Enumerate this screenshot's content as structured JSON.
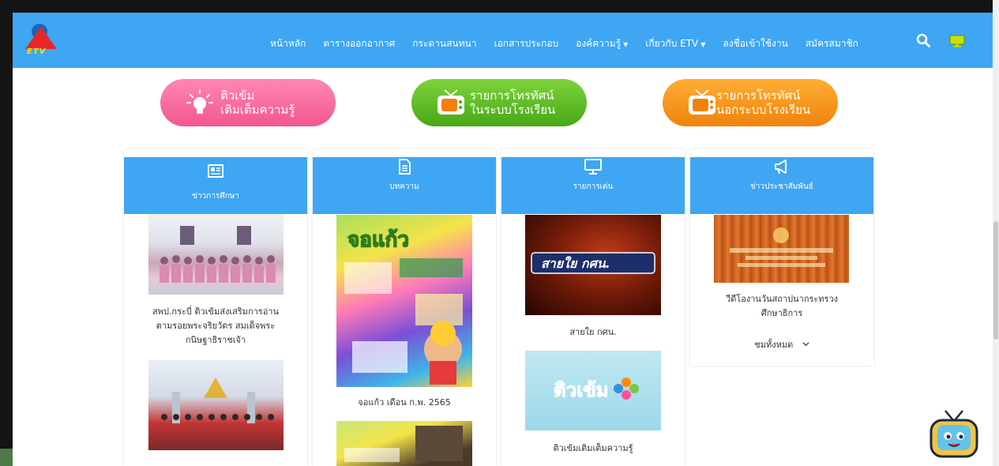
{
  "nav": {
    "logo_text": "ETV",
    "items": [
      {
        "label": "หน้าหลัก"
      },
      {
        "label": "ตารางออกอากาศ"
      },
      {
        "label": "กระดานสนทนา"
      },
      {
        "label": "เอกสารประกอบ"
      },
      {
        "label": "องค์ความรู้",
        "caret": "▼"
      },
      {
        "label": "เกี่ยวกับ ETV",
        "caret": "▼"
      },
      {
        "label": "ลงชื่อเข้าใช้งาน"
      },
      {
        "label": "สมัครสมาชิก"
      }
    ]
  },
  "pills": [
    {
      "line1": "ติวเข้ม",
      "line2": "เติมเต็มความรู้"
    },
    {
      "line1": "รายการโทรทัศน์",
      "line2": "ในระบบโรงเรียน"
    },
    {
      "line1": "รายการโทรทัศน์",
      "line2": "นอกระบบโรงเรียน"
    }
  ],
  "cards": [
    {
      "title": "ข่าวการศึกษา",
      "items": [
        {
          "caption_l1": "สพป.กระบี่ ติวเข้มส่งเสริมการอ่าน",
          "caption_l2": "ตามรอยพระจริยวัตร สมเด็จพระ",
          "caption_l3": "กนิษฐาธิราชเจ้า"
        }
      ]
    },
    {
      "title": "บทความ",
      "items": [
        {
          "caption": "จอแก้ว เดือน ก.พ. 2565",
          "poster_title": "จอแก้ว"
        }
      ]
    },
    {
      "title": "รายการเด่น",
      "items": [
        {
          "caption": "สายใย กศน.",
          "banner": "สายใย กศน."
        },
        {
          "caption": "ติวเข้มเติมเต็มความรู้",
          "banner": "ติวเข้ม"
        }
      ]
    },
    {
      "title": "ข่าวประชาสัมพันธ์",
      "items": [
        {
          "caption_l1": "วีดีโองานวันสถาปนากระทรวง",
          "caption_l2": "ศึกษาธิการ"
        }
      ],
      "more": "ชมทั้งหมด",
      "more_icon": "chevron-down-icon"
    }
  ],
  "colors": {
    "nav": "#3ea6f2",
    "pink": "#f2578f",
    "green": "#47a817",
    "orange": "#f0820c"
  }
}
